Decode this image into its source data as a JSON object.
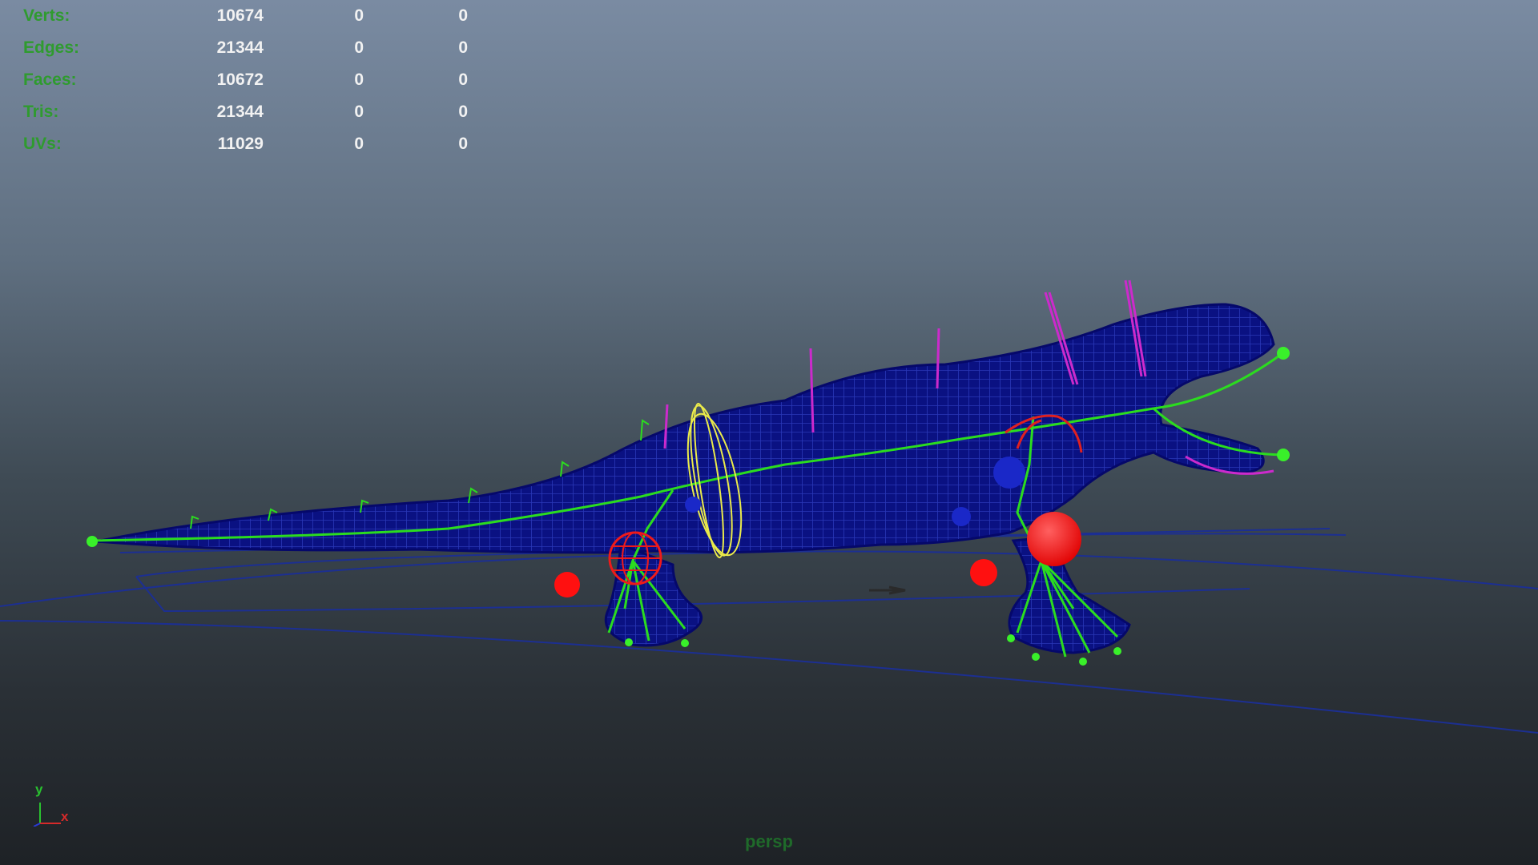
{
  "hud": {
    "rows": [
      {
        "label": "Verts:",
        "v1": "10674",
        "v2": "0",
        "v3": "0"
      },
      {
        "label": "Edges:",
        "v1": "21344",
        "v2": "0",
        "v3": "0"
      },
      {
        "label": "Faces:",
        "v1": "10672",
        "v2": "0",
        "v3": "0"
      },
      {
        "label": "Tris:",
        "v1": "21344",
        "v2": "0",
        "v3": "0"
      },
      {
        "label": "UVs:",
        "v1": "11029",
        "v2": "0",
        "v3": "0"
      }
    ]
  },
  "axis": {
    "y": "y",
    "x": "x"
  },
  "camera": "persp",
  "colors": {
    "mesh": "#0a128e",
    "joint": "#2bdc1f",
    "control": "#d12ad1",
    "ik_handle": "#ff1010",
    "ring": "#e9e94a",
    "pole": "#1b2cc8",
    "ground": "#1a2f8a"
  }
}
